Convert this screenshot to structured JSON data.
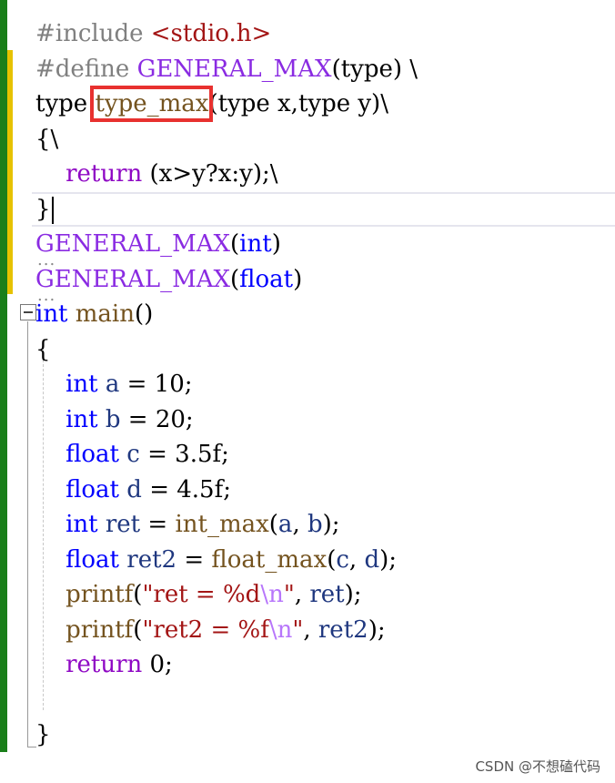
{
  "editor": {
    "lines": [
      {
        "tokens": [
          {
            "t": "#include ",
            "c": "pp"
          },
          {
            "t": "<stdio.h>",
            "c": "str"
          }
        ]
      },
      {
        "tokens": [
          {
            "t": "#define ",
            "c": "pp"
          },
          {
            "t": "GENERAL_MAX",
            "c": "mac"
          },
          {
            "t": "(type) \\",
            "c": ""
          }
        ]
      },
      {
        "tokens": [
          {
            "t": "type ",
            "c": ""
          },
          {
            "t": "type_max",
            "c": "hl"
          },
          {
            "t": "(type x,type y)\\",
            "c": ""
          }
        ]
      },
      {
        "tokens": [
          {
            "t": "{\\",
            "c": ""
          }
        ]
      },
      {
        "tokens": [
          {
            "t": "    ",
            "c": ""
          },
          {
            "t": "return",
            "c": "kwp"
          },
          {
            "t": " (x>y?x:y);\\",
            "c": ""
          }
        ]
      },
      {
        "tokens": [
          {
            "t": "}",
            "c": ""
          },
          {
            "t": "",
            "c": "caret"
          }
        ],
        "current": true
      },
      {
        "tokens": [
          {
            "t": "GENERAL_MAX",
            "c": "mac dots"
          },
          {
            "t": "(",
            "c": ""
          },
          {
            "t": "int",
            "c": "kw"
          },
          {
            "t": ")",
            "c": ""
          }
        ]
      },
      {
        "tokens": [
          {
            "t": "GENERAL_MAX",
            "c": "mac dots"
          },
          {
            "t": "(",
            "c": ""
          },
          {
            "t": "float",
            "c": "kw"
          },
          {
            "t": ")",
            "c": ""
          }
        ]
      },
      {
        "tokens": [
          {
            "t": "int",
            "c": "kw"
          },
          {
            "t": " ",
            "c": ""
          },
          {
            "t": "main",
            "c": "fn"
          },
          {
            "t": "()",
            "c": ""
          }
        ]
      },
      {
        "tokens": [
          {
            "t": "{",
            "c": ""
          }
        ]
      },
      {
        "tokens": [
          {
            "t": "    ",
            "c": ""
          },
          {
            "t": "int",
            "c": "kw"
          },
          {
            "t": " ",
            "c": ""
          },
          {
            "t": "a",
            "c": "var"
          },
          {
            "t": " = 10;",
            "c": ""
          }
        ]
      },
      {
        "tokens": [
          {
            "t": "    ",
            "c": ""
          },
          {
            "t": "int",
            "c": "kw"
          },
          {
            "t": " ",
            "c": ""
          },
          {
            "t": "b",
            "c": "var"
          },
          {
            "t": " = 20;",
            "c": ""
          }
        ]
      },
      {
        "tokens": [
          {
            "t": "    ",
            "c": ""
          },
          {
            "t": "float",
            "c": "kw"
          },
          {
            "t": " ",
            "c": ""
          },
          {
            "t": "c",
            "c": "var"
          },
          {
            "t": " = 3.5f;",
            "c": ""
          }
        ]
      },
      {
        "tokens": [
          {
            "t": "    ",
            "c": ""
          },
          {
            "t": "float",
            "c": "kw"
          },
          {
            "t": " ",
            "c": ""
          },
          {
            "t": "d",
            "c": "var"
          },
          {
            "t": " = 4.5f;",
            "c": ""
          }
        ]
      },
      {
        "tokens": [
          {
            "t": "    ",
            "c": ""
          },
          {
            "t": "int",
            "c": "kw"
          },
          {
            "t": " ",
            "c": ""
          },
          {
            "t": "ret",
            "c": "var"
          },
          {
            "t": " = ",
            "c": ""
          },
          {
            "t": "int_max",
            "c": "fn"
          },
          {
            "t": "(",
            "c": ""
          },
          {
            "t": "a",
            "c": "var"
          },
          {
            "t": ", ",
            "c": ""
          },
          {
            "t": "b",
            "c": "var"
          },
          {
            "t": ");",
            "c": ""
          }
        ]
      },
      {
        "tokens": [
          {
            "t": "    ",
            "c": ""
          },
          {
            "t": "float",
            "c": "kw"
          },
          {
            "t": " ",
            "c": ""
          },
          {
            "t": "ret2",
            "c": "var"
          },
          {
            "t": " = ",
            "c": ""
          },
          {
            "t": "float_max",
            "c": "fn"
          },
          {
            "t": "(",
            "c": ""
          },
          {
            "t": "c",
            "c": "var"
          },
          {
            "t": ", ",
            "c": ""
          },
          {
            "t": "d",
            "c": "var"
          },
          {
            "t": ");",
            "c": ""
          }
        ]
      },
      {
        "tokens": [
          {
            "t": "    ",
            "c": ""
          },
          {
            "t": "printf",
            "c": "fn"
          },
          {
            "t": "(",
            "c": ""
          },
          {
            "t": "\"ret = %d",
            "c": "str"
          },
          {
            "t": "\\n",
            "c": "esc"
          },
          {
            "t": "\"",
            "c": "str"
          },
          {
            "t": ", ",
            "c": ""
          },
          {
            "t": "ret",
            "c": "var"
          },
          {
            "t": ");",
            "c": ""
          }
        ]
      },
      {
        "tokens": [
          {
            "t": "    ",
            "c": ""
          },
          {
            "t": "printf",
            "c": "fn"
          },
          {
            "t": "(",
            "c": ""
          },
          {
            "t": "\"ret2 = %f",
            "c": "str"
          },
          {
            "t": "\\n",
            "c": "esc"
          },
          {
            "t": "\"",
            "c": "str"
          },
          {
            "t": ", ",
            "c": ""
          },
          {
            "t": "ret2",
            "c": "var"
          },
          {
            "t": ");",
            "c": ""
          }
        ]
      },
      {
        "tokens": [
          {
            "t": "    ",
            "c": ""
          },
          {
            "t": "return",
            "c": "kwp"
          },
          {
            "t": " 0;",
            "c": ""
          }
        ]
      },
      {
        "tokens": [
          {
            "t": "",
            "c": ""
          }
        ]
      },
      {
        "tokens": [
          {
            "t": "}",
            "c": ""
          }
        ]
      }
    ]
  },
  "watermark": "CSDN @不想磕代码",
  "colors": {
    "keyword": "#0000ff",
    "control_keyword": "#8f08c4",
    "preprocessor": "#808080",
    "macro": "#8a2be2",
    "function": "#74531f",
    "string": "#a31515",
    "escape": "#b776fb",
    "variable": "#1f377f",
    "highlight_box": "#e8312f",
    "change_bar": "#1a7f1a"
  },
  "icons": {
    "fold_toggle": "collapse-minus-icon"
  }
}
